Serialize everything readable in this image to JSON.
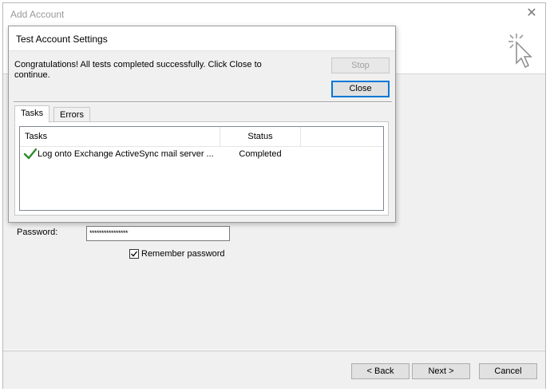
{
  "window": {
    "title": "Add Account"
  },
  "account_form": {
    "password_label": "Password:",
    "password_value": "****************",
    "remember_label": "Remember password",
    "remember_checked": true
  },
  "footer": {
    "back_label": "< Back",
    "next_label": "Next >",
    "cancel_label": "Cancel"
  },
  "dialog": {
    "title": "Test Account Settings",
    "message": "Congratulations! All tests completed successfully. Click Close to continue.",
    "stop_label": "Stop",
    "close_label": "Close",
    "tabs": [
      {
        "label": "Tasks",
        "active": true
      },
      {
        "label": "Errors",
        "active": false
      }
    ],
    "list": {
      "columns": [
        "Tasks",
        "Status"
      ],
      "rows": [
        {
          "task": "Log onto Exchange ActiveSync mail server ...",
          "status": "Completed",
          "icon": "green-check-icon"
        }
      ]
    }
  },
  "colors": {
    "focus_border": "#0078d7",
    "check_green": "#2e8b2e"
  }
}
